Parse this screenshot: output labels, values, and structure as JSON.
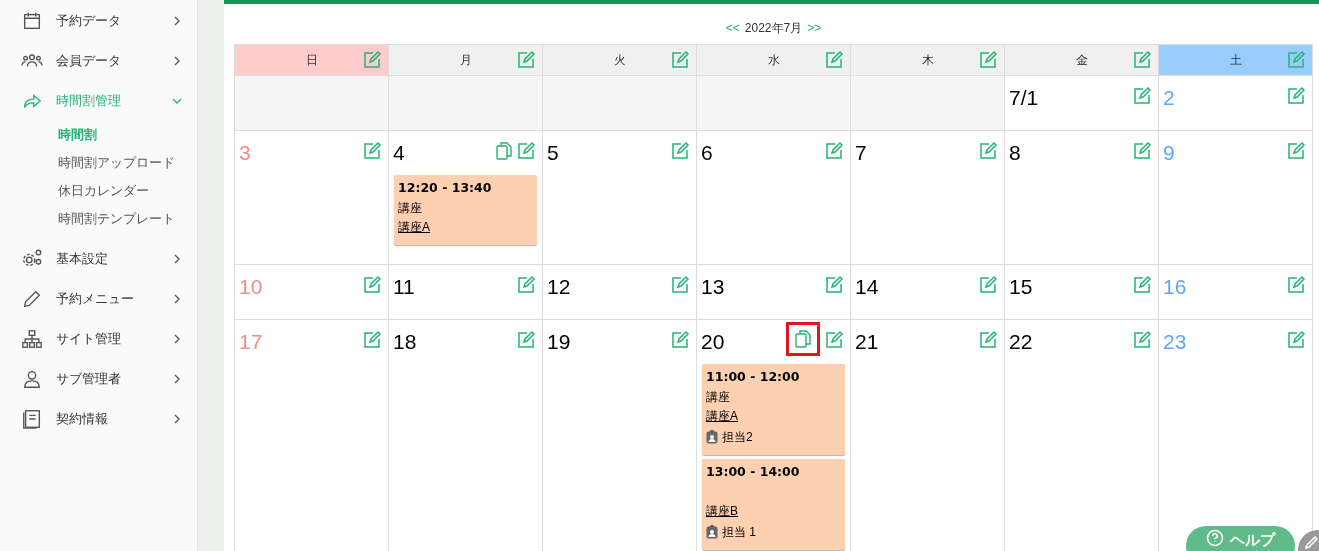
{
  "sidebar": {
    "items": [
      {
        "label": "予約データ",
        "expanded": false,
        "selected": false
      },
      {
        "label": "会員データ",
        "expanded": false,
        "selected": false
      },
      {
        "label": "時間割管理",
        "expanded": true,
        "selected": true,
        "children": [
          {
            "label": "時間割",
            "selected": true
          },
          {
            "label": "時間割アップロード",
            "selected": false
          },
          {
            "label": "休日カレンダー",
            "selected": false
          },
          {
            "label": "時間割テンプレート",
            "selected": false
          }
        ]
      },
      {
        "label": "基本設定",
        "expanded": false,
        "selected": false
      },
      {
        "label": "予約メニュー",
        "expanded": false,
        "selected": false
      },
      {
        "label": "サイト管理",
        "expanded": false,
        "selected": false
      },
      {
        "label": "サブ管理者",
        "expanded": false,
        "selected": false
      },
      {
        "label": "契約情報",
        "expanded": false,
        "selected": false
      }
    ]
  },
  "calendar": {
    "prev": "<<",
    "month": "2022年7月",
    "next": ">>",
    "weekdays": [
      {
        "label": "日",
        "kind": "sun"
      },
      {
        "label": "月",
        "kind": "weekday"
      },
      {
        "label": "火",
        "kind": "weekday"
      },
      {
        "label": "水",
        "kind": "weekday"
      },
      {
        "label": "木",
        "kind": "weekday"
      },
      {
        "label": "金",
        "kind": "weekday"
      },
      {
        "label": "土",
        "kind": "sat"
      }
    ],
    "weeks": [
      {
        "days": [
          {
            "kind": "empty"
          },
          {
            "kind": "empty"
          },
          {
            "kind": "empty"
          },
          {
            "kind": "empty"
          },
          {
            "kind": "empty"
          },
          {
            "kind": "weekday",
            "label": "7/1",
            "copy": false
          },
          {
            "kind": "sat",
            "label": "2",
            "copy": false
          }
        ]
      },
      {
        "days": [
          {
            "kind": "sun",
            "label": "3",
            "copy": false
          },
          {
            "kind": "weekday",
            "label": "4",
            "copy": true,
            "highlighted": false,
            "events": [
              {
                "time": "12:20 - 13:40",
                "type": "講座",
                "course": "講座A"
              }
            ]
          },
          {
            "kind": "weekday",
            "label": "5",
            "copy": false
          },
          {
            "kind": "weekday",
            "label": "6",
            "copy": false
          },
          {
            "kind": "weekday",
            "label": "7",
            "copy": false
          },
          {
            "kind": "weekday",
            "label": "8",
            "copy": false
          },
          {
            "kind": "sat",
            "label": "9",
            "copy": false
          }
        ]
      },
      {
        "days": [
          {
            "kind": "sun",
            "label": "10",
            "copy": false
          },
          {
            "kind": "weekday",
            "label": "11",
            "copy": false
          },
          {
            "kind": "weekday",
            "label": "12",
            "copy": false
          },
          {
            "kind": "weekday",
            "label": "13",
            "copy": false
          },
          {
            "kind": "weekday",
            "label": "14",
            "copy": false
          },
          {
            "kind": "weekday",
            "label": "15",
            "copy": false
          },
          {
            "kind": "sat",
            "label": "16",
            "copy": false
          }
        ]
      },
      {
        "days": [
          {
            "kind": "sun",
            "label": "17",
            "copy": false
          },
          {
            "kind": "weekday",
            "label": "18",
            "copy": false
          },
          {
            "kind": "weekday",
            "label": "19",
            "copy": false
          },
          {
            "kind": "weekday",
            "label": "20",
            "copy": true,
            "highlighted": true,
            "events": [
              {
                "time": "11:00 - 12:00",
                "type": "講座",
                "course": "講座A",
                "staff": "担当2"
              },
              {
                "time": "13:00 - 14:00",
                "course": "講座B",
                "staff": "担当 1"
              }
            ]
          },
          {
            "kind": "weekday",
            "label": "21",
            "copy": false
          },
          {
            "kind": "weekday",
            "label": "22",
            "copy": false
          },
          {
            "kind": "sat",
            "label": "23",
            "copy": false
          }
        ]
      }
    ]
  },
  "help_button": {
    "label": "ヘルプ"
  }
}
